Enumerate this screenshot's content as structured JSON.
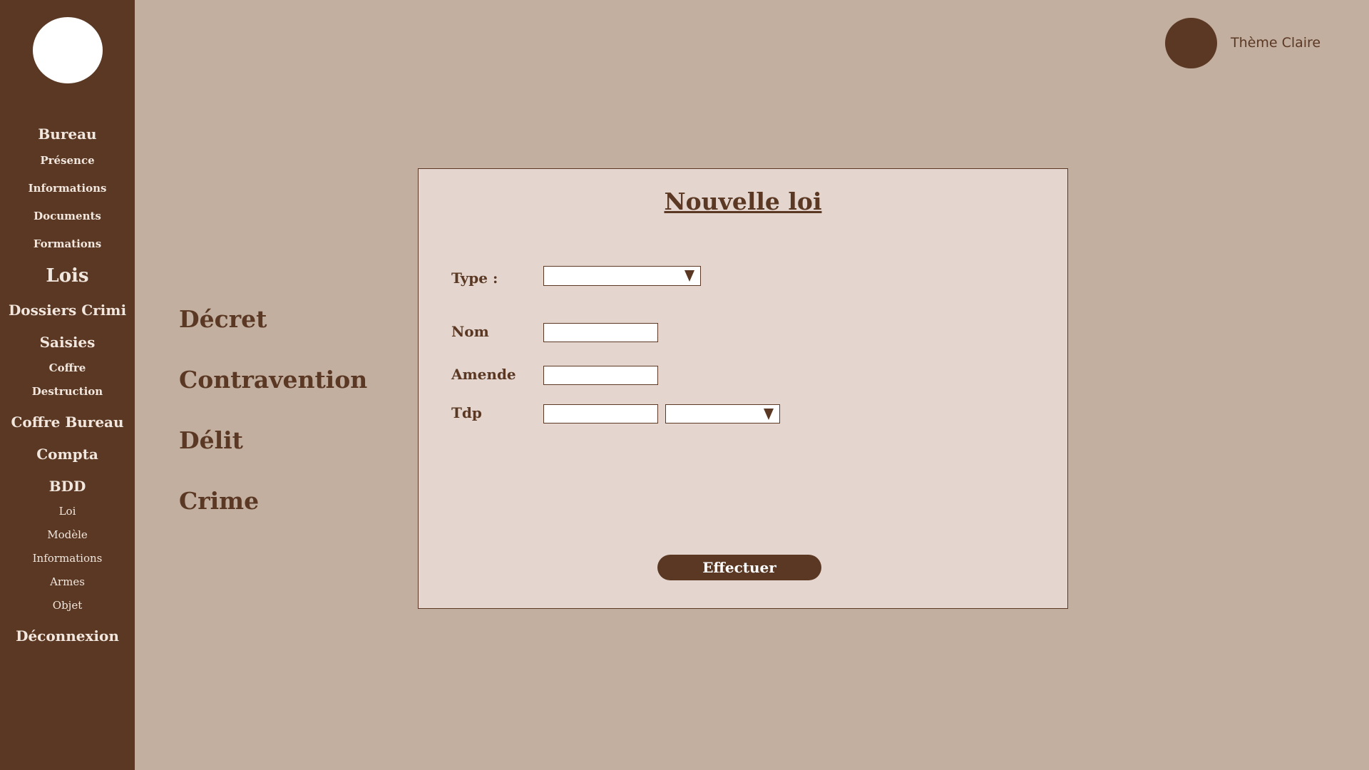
{
  "sidebar": {
    "logo_icon": "logo-circle",
    "items": [
      {
        "label": "Bureau"
      },
      {
        "label": "Présence"
      },
      {
        "label": "Informations"
      },
      {
        "label": "Documents"
      },
      {
        "label": "Formations"
      },
      {
        "label": "Lois"
      },
      {
        "label": "Dossiers Crimi"
      },
      {
        "label": "Saisies"
      },
      {
        "label": "Coffre"
      },
      {
        "label": "Destruction"
      },
      {
        "label": "Coffre Bureau"
      },
      {
        "label": "Compta"
      },
      {
        "label": "BDD"
      },
      {
        "label": "Loi"
      },
      {
        "label": "Modèle"
      },
      {
        "label": "Informations"
      },
      {
        "label": "Armes"
      },
      {
        "label": "Objet"
      },
      {
        "label": "Déconnexion"
      }
    ]
  },
  "header": {
    "theme_toggle_icon": "theme-circle",
    "theme_label": "Thème Claire"
  },
  "categories": [
    {
      "label": "Décret"
    },
    {
      "label": "Contravention"
    },
    {
      "label": "Délit"
    },
    {
      "label": "Crime"
    }
  ],
  "form": {
    "title": "Nouvelle loi",
    "type_label": "Type :",
    "type_value": "",
    "nom_label": "Nom",
    "nom_value": "",
    "amende_label": "Amende",
    "amende_value": "",
    "tdp_label": "Tdp",
    "tdp_value": "",
    "tdp_unit_value": "",
    "submit_label": "Effectuer"
  },
  "colors": {
    "sidebar": "#5a3823",
    "background": "#c2afa0",
    "panel": "#e4d6ce",
    "accent": "#5a3823"
  }
}
